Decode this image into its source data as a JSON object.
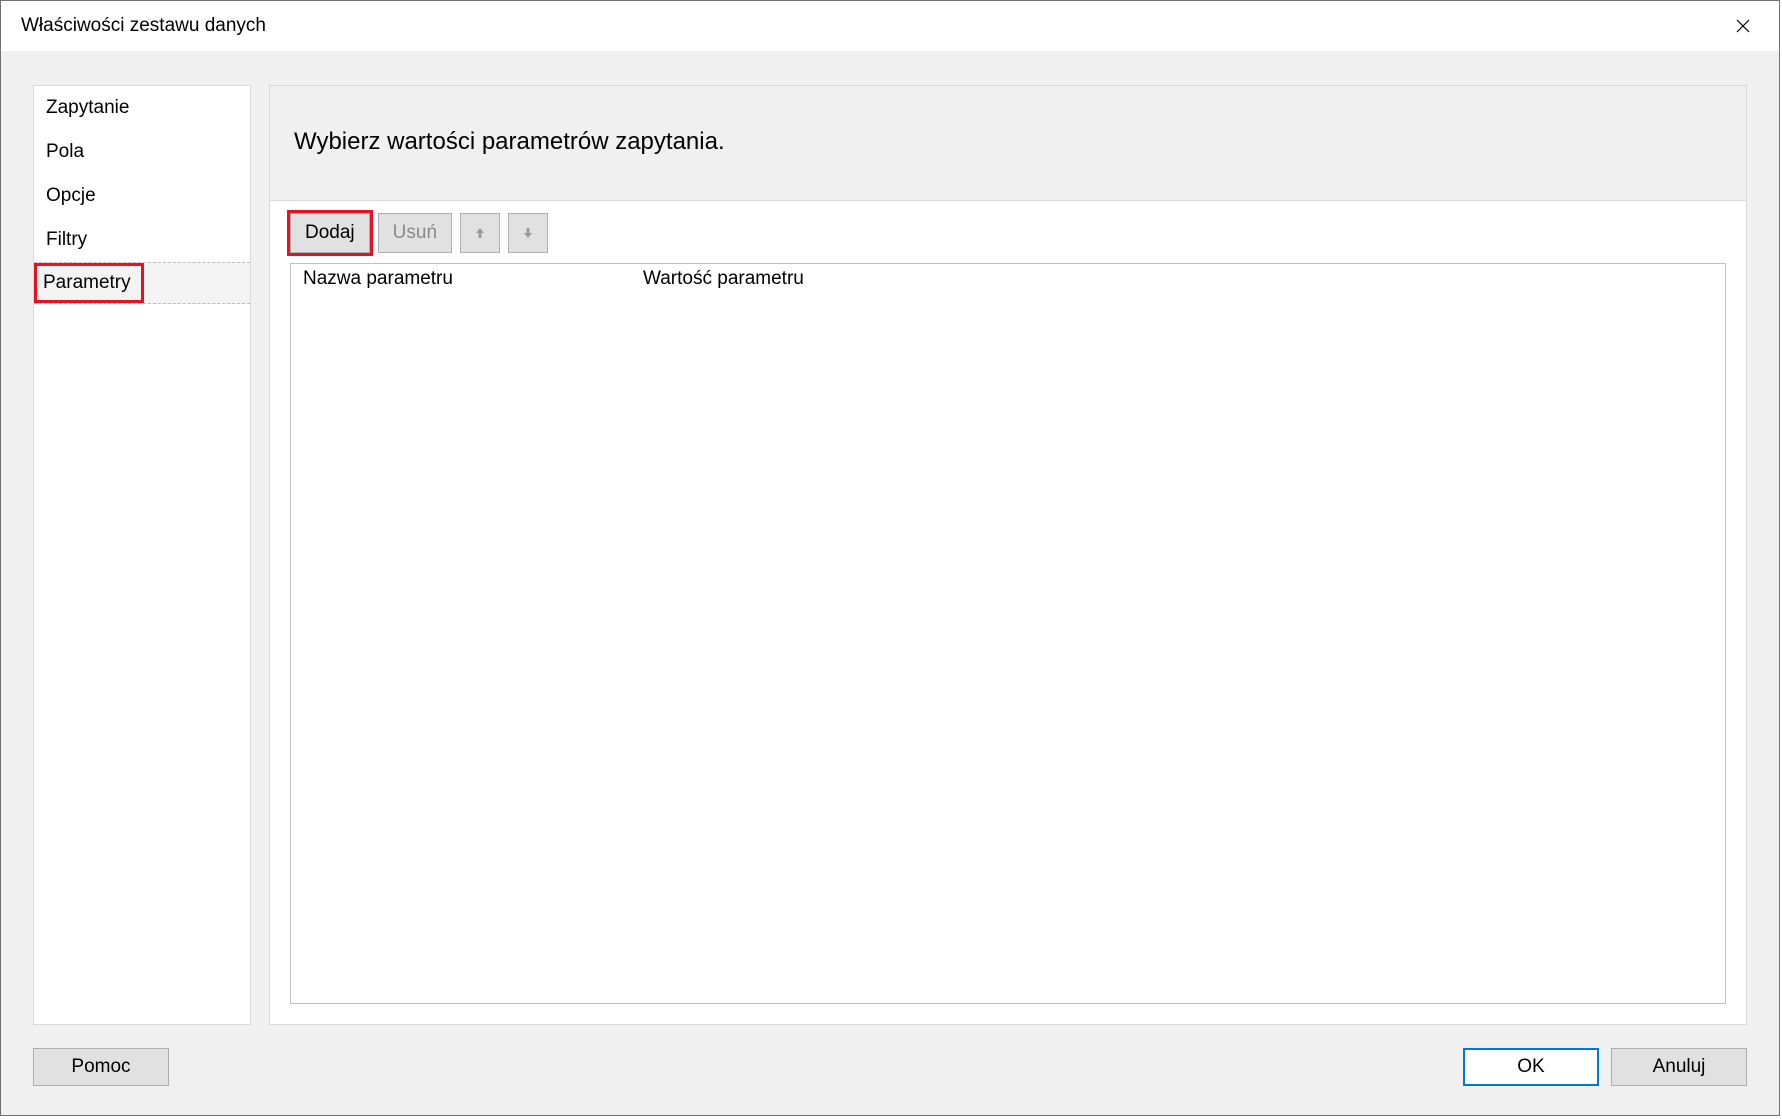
{
  "window": {
    "title": "Właściwości zestawu danych"
  },
  "sidebar": {
    "items": [
      {
        "label": "Zapytanie"
      },
      {
        "label": "Pola"
      },
      {
        "label": "Opcje"
      },
      {
        "label": "Filtry"
      },
      {
        "label": "Parametry"
      }
    ],
    "selected_index": 4
  },
  "main": {
    "header": "Wybierz wartości parametrów zapytania.",
    "toolbar": {
      "add_label": "Dodaj",
      "delete_label": "Usuń",
      "move_up_icon": "arrow-up-icon",
      "move_down_icon": "arrow-down-icon"
    },
    "grid": {
      "columns": [
        {
          "label": "Nazwa parametru"
        },
        {
          "label": "Wartość parametru"
        }
      ],
      "rows": []
    }
  },
  "footer": {
    "help_label": "Pomoc",
    "ok_label": "OK",
    "cancel_label": "Anuluj"
  },
  "highlights": {
    "sidebar_item_parametry": true,
    "add_button": true
  }
}
